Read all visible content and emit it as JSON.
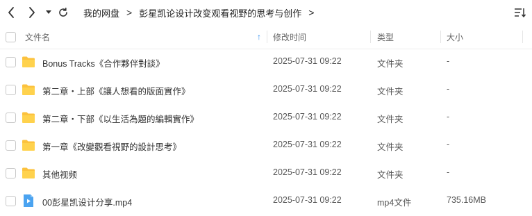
{
  "toolbar": {
    "breadcrumb": [
      "我的网盘",
      "彭星凯论设计改变观看视野的思考与创作"
    ]
  },
  "columns": {
    "name": "文件名",
    "modified": "修改时间",
    "type": "类型",
    "size": "大小"
  },
  "files": [
    {
      "name": "Bonus Tracks《合作夥伴對談》",
      "modified": "2025-07-31 09:22",
      "type": "文件夹",
      "size": "-",
      "icon": "folder-icon"
    },
    {
      "name": "第二章・上部《讓人想看的版面實作》",
      "modified": "2025-07-31 09:22",
      "type": "文件夹",
      "size": "-",
      "icon": "folder-icon"
    },
    {
      "name": "第二章・下部《以生活為題的編輯實作》",
      "modified": "2025-07-31 09:22",
      "type": "文件夹",
      "size": "-",
      "icon": "folder-icon"
    },
    {
      "name": "第一章《改變觀看視野的設計思考》",
      "modified": "2025-07-31 09:22",
      "type": "文件夹",
      "size": "-",
      "icon": "folder-icon"
    },
    {
      "name": "其他视频",
      "modified": "2025-07-31 09:22",
      "type": "文件夹",
      "size": "-",
      "icon": "folder-icon"
    },
    {
      "name": "00彭星凯设计分享.mp4",
      "modified": "2025-07-31 09:22",
      "type": "mp4文件",
      "size": "735.16MB",
      "icon": "video-file-icon"
    }
  ],
  "colors": {
    "folder": "#fcc23e",
    "video": "#4ba3f0",
    "accent": "#2b8cf0"
  }
}
